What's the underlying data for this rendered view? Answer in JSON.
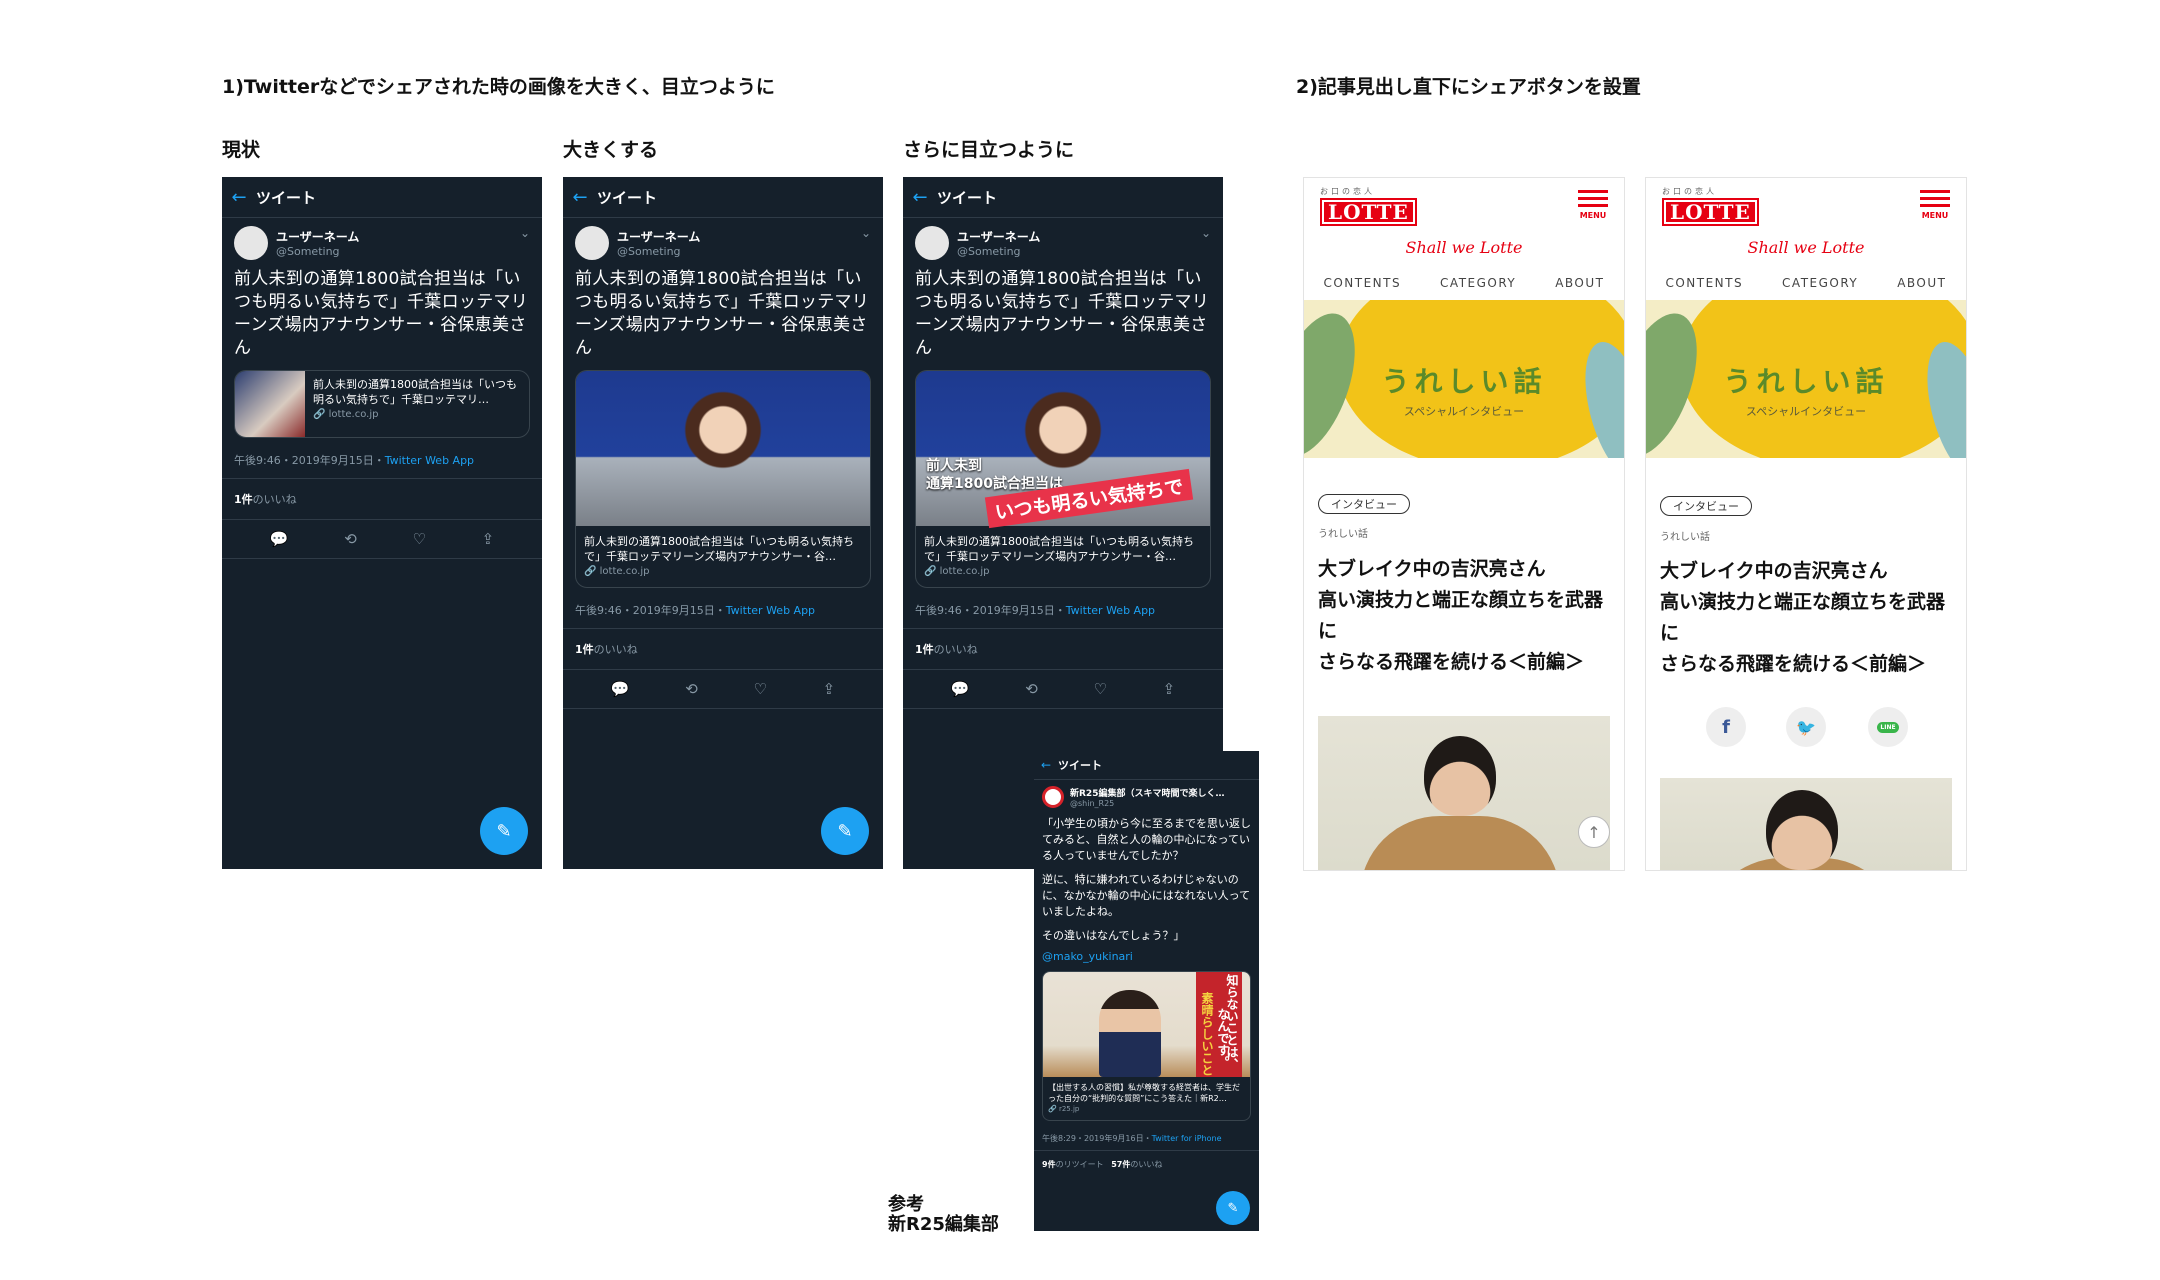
{
  "section1": {
    "title": "1)Twitterなどでシェアされた時の画像を大きく、目立つように"
  },
  "section2": {
    "title": "2)記事見出し直下にシェアボタンを設置"
  },
  "columns": {
    "current": "現状",
    "bigger": "大きくする",
    "stand_out": "さらに目立つように"
  },
  "tweet": {
    "back": "←",
    "header": "ツイート",
    "username": "ユーザーネーム",
    "handle": "@Someting",
    "text": "前人未到の通算1800試合担当は「いつも明るい気持ちで」千葉ロッテマリーンズ場内アナウンサー・谷保恵美さん",
    "card_small_text": "前人未到の通算1800試合担当は「いつも明るい気持ちで」千葉ロッテマリ…",
    "card_text": "前人未到の通算1800試合担当は「いつも明るい気持ちで」千葉ロッテマリーンズ場内アナウンサー・谷…",
    "card_domain": "lotte.co.jp",
    "time": "午後9:46・2019年9月15日・",
    "via": "Twitter Web App",
    "likes_count": "1件",
    "likes_label": "のいいね",
    "overlay_line1": "前人未到",
    "overlay_line2": "通算1800試合担当は",
    "overlay_banner": "いつも明るい気持ちで"
  },
  "icons": {
    "reply": "💬",
    "retweet": "⟲",
    "like": "♡",
    "share": "⇪",
    "fab": "✎"
  },
  "r25": {
    "header": "ツイート",
    "name": "新R25編集部（スキマ時間で楽しく…",
    "handle": "@shin_R25",
    "p1": "「小学生の頃から今に至るまでを思い返してみると、自然と人の輪の中心になっている人っていませんでしたか？",
    "p2": "逆に、特に嫌われているわけじゃないのに、なかなか輪の中心にはなれない人っていましたよね。",
    "p3": "その違いはなんでしょう？」",
    "mention": "@mako_yukinari",
    "banner_text": "知らないことは、",
    "banner_text2": "素晴らしいこと",
    "banner_text3": "なんです。",
    "card_text": "【出世する人の習慣】私が尊敬する経営者は、学生だった自分の“批判的な質問”にこう答えた｜新R2…",
    "card_domain": "r25.jp",
    "time": "午後8:29・2019年9月16日・",
    "via": "Twitter for iPhone",
    "retweets": "9件",
    "retweets_label": "のリツイート",
    "likes": "57件",
    "likes_label": "のいいね"
  },
  "reference": {
    "label": "参考",
    "name": "新R25編集部"
  },
  "lotte": {
    "logo_small": "お口の恋人",
    "logo": "LOTTE",
    "menu": "MENU",
    "script": "Shall we Lotte",
    "nav": [
      "CONTENTS",
      "CATEGORY",
      "ABOUT"
    ],
    "hero_title": "うれしい話",
    "hero_sub": "スペシャルインタビュー",
    "tag": "インタビュー",
    "category": "うれしい話",
    "title1": "大ブレイク中の吉沢亮さん",
    "title2": "高い演技力と端正な顔立ちを武器に",
    "title3": "さらなる飛躍を続ける＜前編＞",
    "up": "↑",
    "share_facebook": "f",
    "share_twitter": "🐦",
    "share_line": "LINE"
  },
  "colors": {
    "twitter_bg": "#15202b",
    "twitter_blue": "#1da1f2",
    "lotte_red": "#e60012",
    "hero_yellow": "#f2c318"
  }
}
